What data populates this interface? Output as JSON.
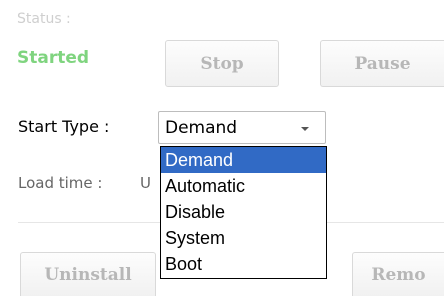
{
  "status": {
    "label": "Status :",
    "value": "Started"
  },
  "buttons": {
    "stop": "Stop",
    "pause": "Pause",
    "uninstall": "Uninstall",
    "remove": "Remo"
  },
  "start_type": {
    "label": "Start Type :",
    "selected": "Demand",
    "options": [
      "Demand",
      "Automatic",
      "Disable",
      "System",
      "Boot"
    ],
    "highlighted_index": 0
  },
  "load_time": {
    "label": "Load time :",
    "value_partial": "U"
  },
  "colors": {
    "status_value": "#7fd47f",
    "highlight": "#316ac5"
  }
}
